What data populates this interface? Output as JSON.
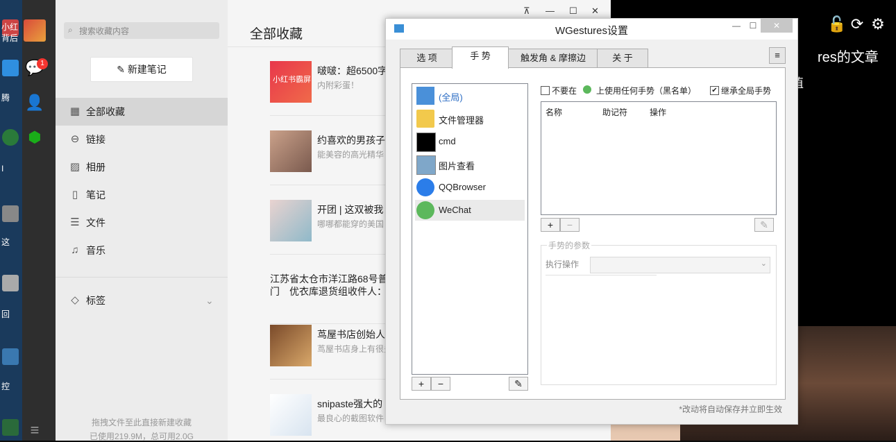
{
  "desktop": {
    "left_labels": [
      "小红",
      "背后",
      "腾",
      "I",
      "这",
      "回",
      "控"
    ],
    "right_title": "res的文章",
    "right_sub": "值"
  },
  "wechat": {
    "search_placeholder": "搜索收藏内容",
    "new_note": "新建笔记",
    "badge": "1",
    "nav": [
      {
        "icon": "grid-icon",
        "glyph": "▦",
        "label": "全部收藏",
        "active": true
      },
      {
        "icon": "link-icon",
        "glyph": "⊖",
        "label": "链接",
        "active": false
      },
      {
        "icon": "photo-icon",
        "glyph": "▨",
        "label": "相册",
        "active": false
      },
      {
        "icon": "note-icon",
        "glyph": "▯",
        "label": "笔记",
        "active": false
      },
      {
        "icon": "file-icon",
        "glyph": "☰",
        "label": "文件",
        "active": false
      },
      {
        "icon": "music-icon",
        "glyph": "♫",
        "label": "音乐",
        "active": false
      }
    ],
    "tags_label": "标签",
    "footer_1": "拖拽文件至此直接新建收藏",
    "footer_2": "已使用219.9M，总可用2.0G",
    "main_title": "全部收藏",
    "favorites": [
      {
        "title": "啵啵：超6500字",
        "sub": "内附彩蛋！",
        "thumb_text": "小红书霸屏"
      },
      {
        "title": "约喜欢的男孩子",
        "sub": "能美容的高光精华",
        "thumb_text": ""
      },
      {
        "title": "开团 | 这双被我",
        "sub": "哪哪都能穿的美国",
        "thumb_text": ""
      },
      {
        "title": "江苏省太仓市洋江路68号普",
        "sub": "门　优衣库退货组收件人：",
        "thumb_text": ""
      },
      {
        "title": "茑屋书店创始人",
        "sub": "茑屋书店身上有很多",
        "thumb_text": ""
      },
      {
        "title": "snipaste强大的",
        "sub": "最良心的截图软件",
        "thumb_text": ""
      }
    ]
  },
  "wgestures": {
    "title": "WGestures设置",
    "tabs": [
      "选 项",
      "手 势",
      "触发角 & 摩擦边",
      "关 于"
    ],
    "active_tab": 1,
    "apps": [
      {
        "label": "(全局)",
        "icon": "cursor-icon"
      },
      {
        "label": "文件管理器",
        "icon": "folder-icon"
      },
      {
        "label": "cmd",
        "icon": "cmd-icon"
      },
      {
        "label": "图片查看",
        "icon": "image-viewer-icon"
      },
      {
        "label": "QQBrowser",
        "icon": "qqbrowser-icon"
      },
      {
        "label": "WeChat",
        "icon": "wechat-icon"
      }
    ],
    "selected_app": 5,
    "disable_label_a": "不要在",
    "disable_label_b": "上使用任何手势（黑名单）",
    "inherit_label": "继承全局手势",
    "inherit_checked": true,
    "disable_checked": false,
    "table_headers": [
      "名称",
      "助记符",
      "操作"
    ],
    "params_legend": "手势的参数",
    "exec_label": "执行操作",
    "footer_note": "*改动将自动保存并立即生效",
    "add_symbol": "+",
    "remove_symbol": "−",
    "menu_symbol": "≡"
  }
}
